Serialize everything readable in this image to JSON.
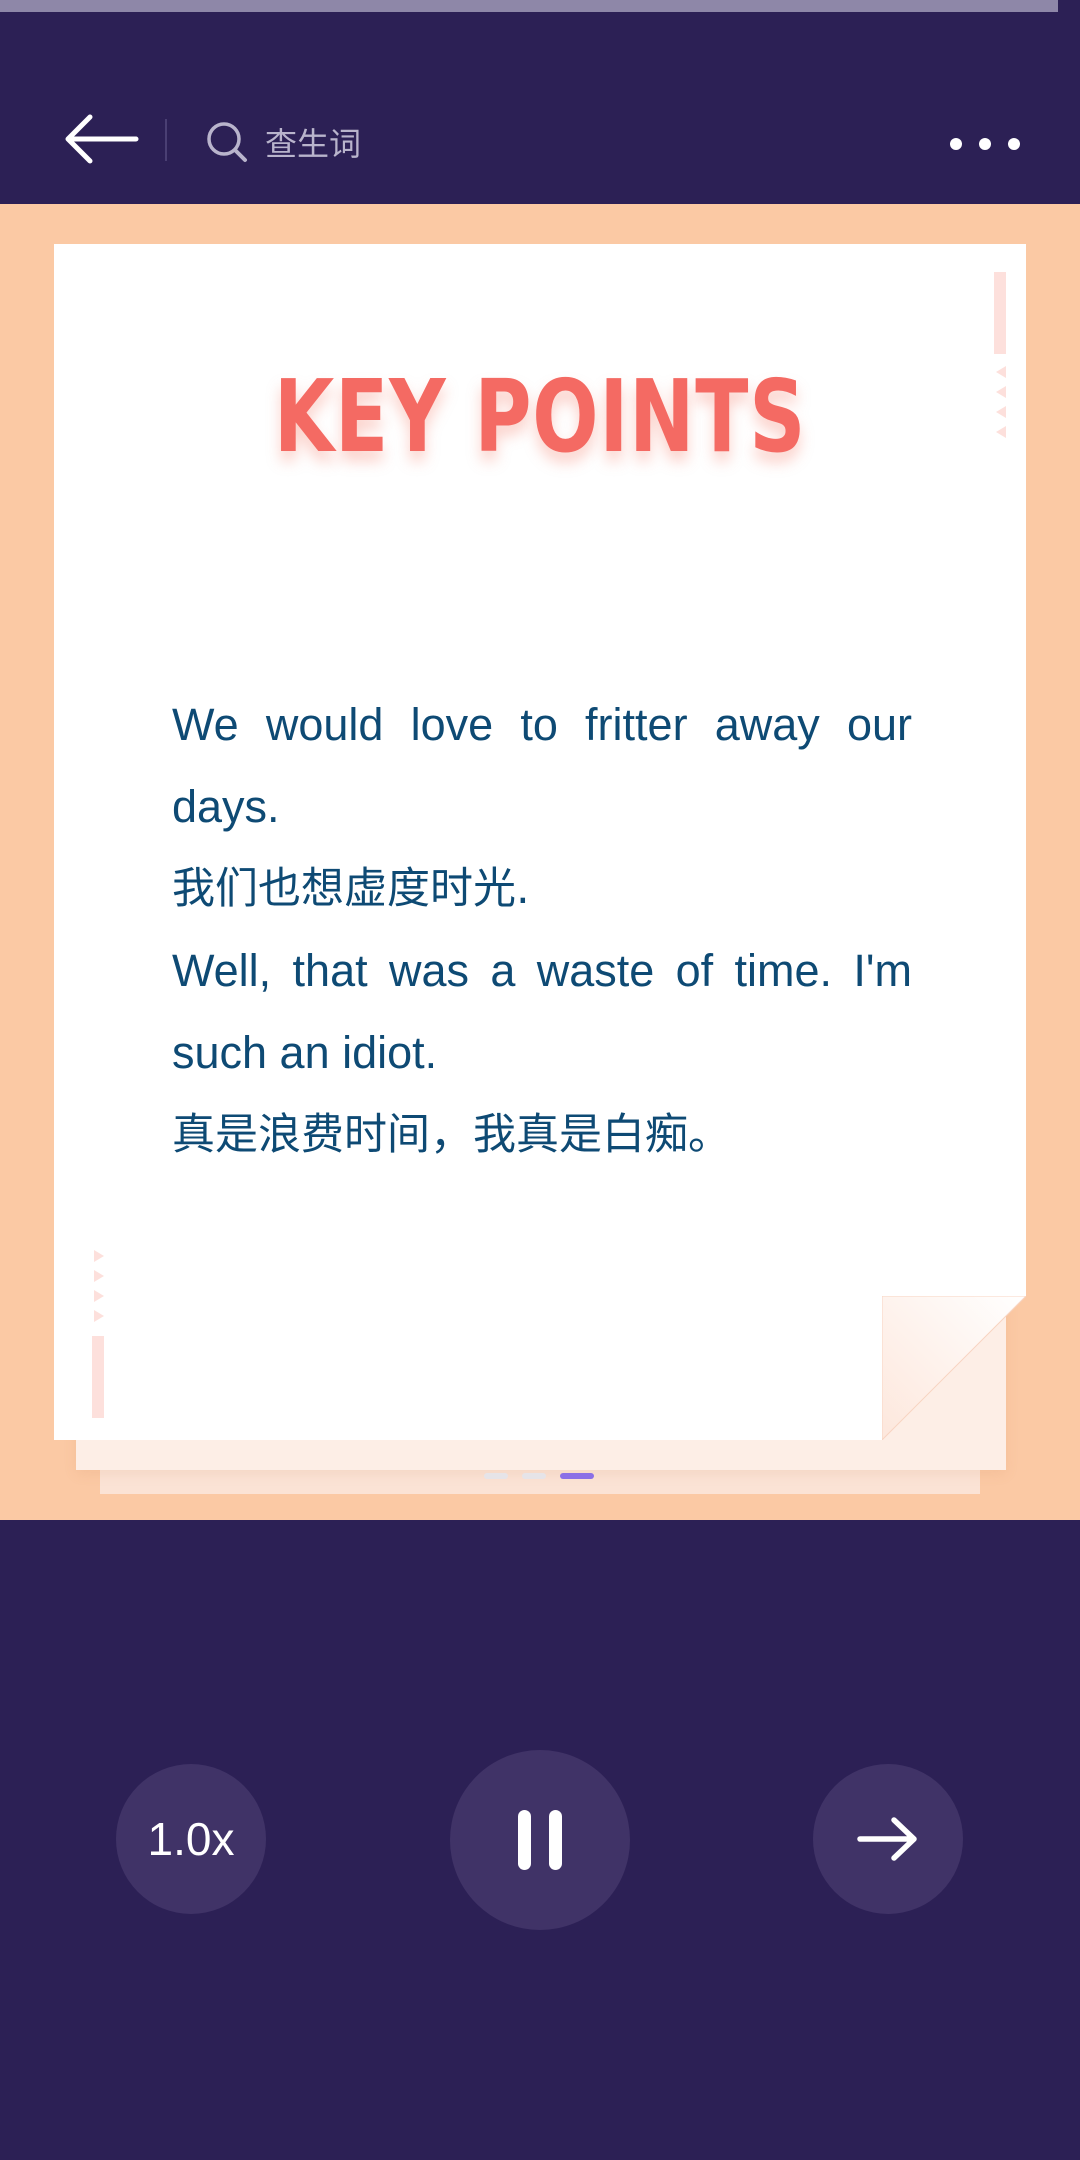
{
  "playback_progress": 0.98,
  "header": {
    "back_icon": "arrow-left-icon",
    "search_icon": "search-icon",
    "search_label": "查生词",
    "more_icon": "more-horizontal-icon"
  },
  "card": {
    "title": "KEY POINTS",
    "lines": [
      "We would love to fritter away our days.",
      "我们也想虚度时光.",
      "Well, that was a waste of time. I'm such an idiot.",
      "真是浪费时间，我真是白痴。"
    ]
  },
  "pager": {
    "total": 3,
    "active_index": 2
  },
  "controls": {
    "speed_label": "1.0x",
    "pause_icon": "pause-icon",
    "next_icon": "arrow-right-icon"
  },
  "colors": {
    "background": "#2c2055",
    "stage": "#fbc9a4",
    "title": "#f46a63",
    "text": "#0e4a74",
    "accent": "#8b6fe6",
    "button": "#403367"
  }
}
